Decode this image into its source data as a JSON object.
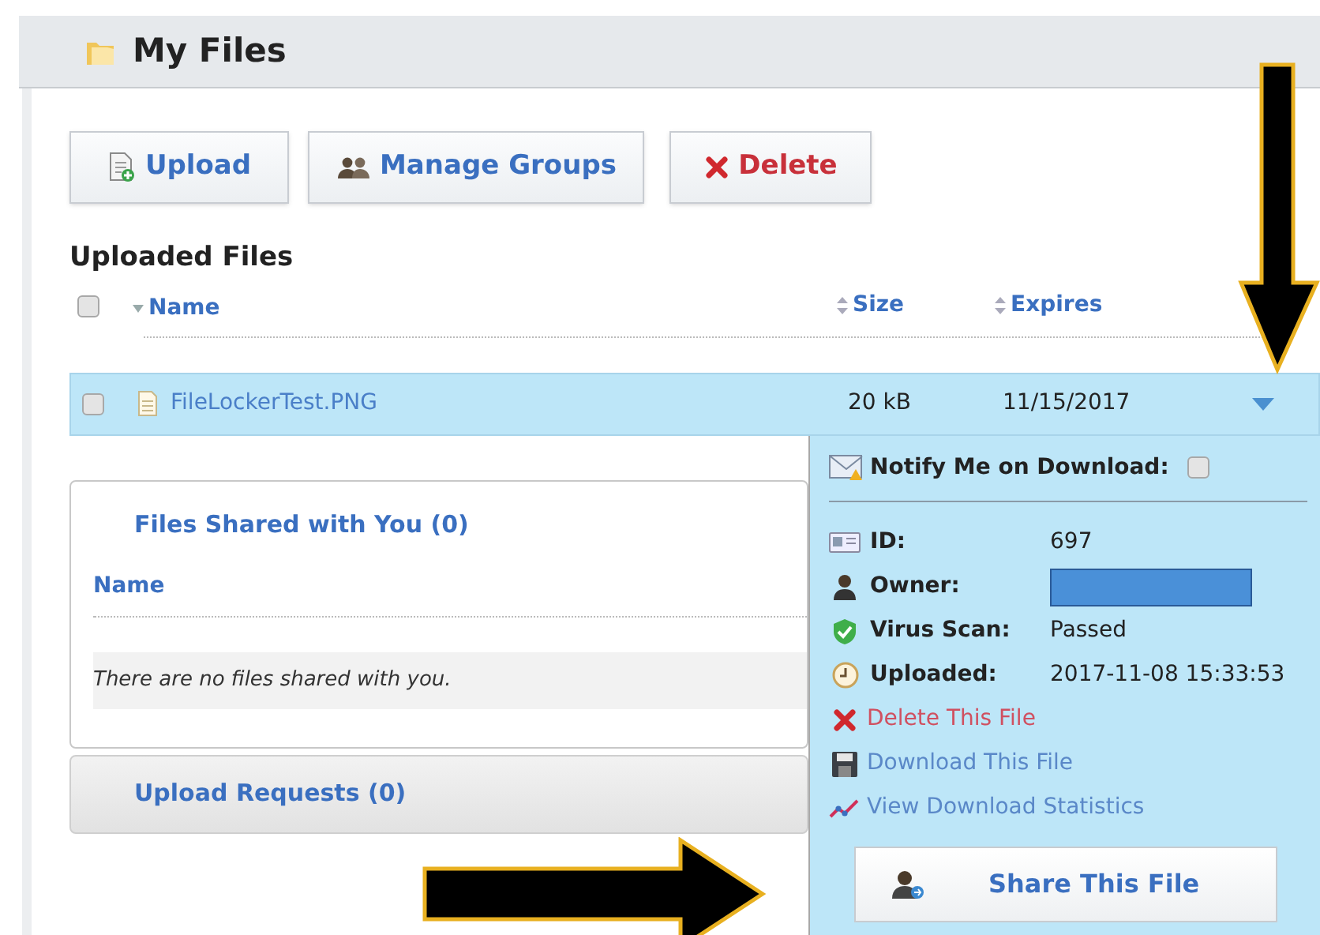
{
  "header": {
    "title": "My Files"
  },
  "toolbar": [
    {
      "kind": "upload",
      "label": "Upload"
    },
    {
      "kind": "groups",
      "label": "Manage Groups"
    },
    {
      "kind": "delete",
      "label": "Delete"
    }
  ],
  "uploaded_files": {
    "title": "Uploaded Files",
    "select_all_checked": false,
    "columns": [
      {
        "label": "Name",
        "sorted": true
      },
      {
        "label": "Size",
        "sorted": false
      },
      {
        "label": "Expires",
        "sorted": false
      }
    ],
    "rows": [
      {
        "name": "FileLockerTest.PNG",
        "size": "20 kB",
        "expires": "11/15/2017",
        "checked": false,
        "selected": true,
        "expanded": true
      }
    ]
  },
  "details": {
    "notify_label": "Notify Me on Download:",
    "notify_checked": false,
    "fields": [
      {
        "kind": "id",
        "label": "ID:",
        "value": "697"
      },
      {
        "kind": "owner",
        "label": "Owner:",
        "redacted": true
      },
      {
        "kind": "scan",
        "label": "Virus Scan:",
        "value": "Passed"
      },
      {
        "kind": "uploaded",
        "label": "Uploaded:",
        "value": "2017-11-08 15:33:53"
      }
    ],
    "actions": [
      {
        "kind": "delete",
        "label": "Delete This File"
      },
      {
        "kind": "download",
        "label": "Download This File"
      },
      {
        "kind": "stats",
        "label": "View Download Statistics"
      }
    ],
    "share_button": "Share This File"
  },
  "shared_panel": {
    "title": "Files Shared with You (0)",
    "column": "Name",
    "empty_text": "There are no files shared with you."
  },
  "requests_panel": {
    "title": "Upload Requests (0)"
  }
}
